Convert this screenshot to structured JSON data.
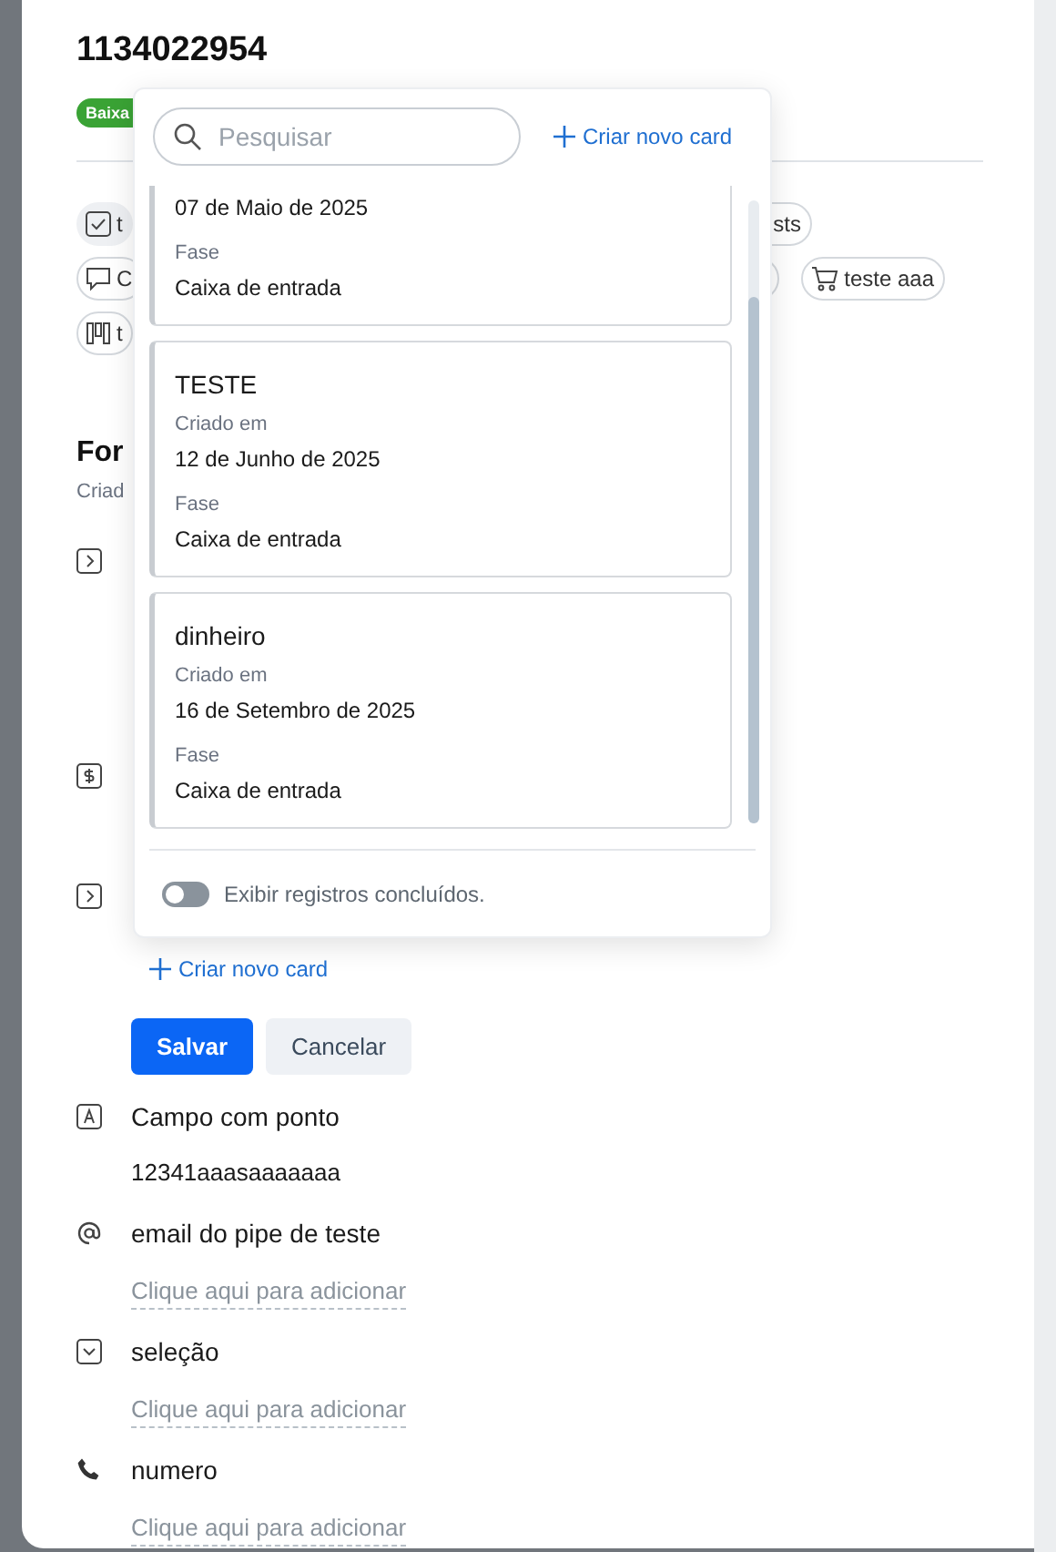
{
  "card": {
    "title": "1134022954",
    "badge": "Baixa",
    "chips": [
      {
        "kind": "checklist",
        "label": "t",
        "selected": true
      },
      {
        "kind": "plain",
        "label": "sts",
        "selected": false
      },
      {
        "kind": "comment",
        "label": "C",
        "selected": false
      },
      {
        "kind": "empty",
        "selected": false
      },
      {
        "kind": "cart",
        "label": "teste aaa",
        "selected": false
      },
      {
        "kind": "kanban",
        "label": "t",
        "selected": false
      }
    ],
    "section": {
      "title": "For",
      "subtitle": "Criad"
    },
    "create_link": "Criar novo card",
    "buttons": {
      "save": "Salvar",
      "cancel": "Cancelar"
    },
    "fields": [
      {
        "kind": "text",
        "label": "Campo com ponto",
        "value": "12341aaasaaaaaaa"
      },
      {
        "kind": "email",
        "label": "email do pipe de teste",
        "placeholder": "Clique aqui para adicionar"
      },
      {
        "kind": "select",
        "label": "seleção",
        "placeholder": "Clique aqui para adicionar"
      },
      {
        "kind": "phone",
        "label": "numero",
        "placeholder": "Clique aqui para adicionar"
      }
    ]
  },
  "popover": {
    "search": {
      "placeholder": "Pesquisar"
    },
    "create_link": "Criar novo card",
    "records": [
      {
        "date": "07 de Maio de 2025",
        "phase_label": "Fase",
        "phase": "Caixa de entrada"
      },
      {
        "title": "TESTE",
        "created_label": "Criado em",
        "date": "12 de Junho de 2025",
        "phase_label": "Fase",
        "phase": "Caixa de entrada"
      },
      {
        "title": "dinheiro",
        "created_label": "Criado em",
        "date": "16 de Setembro de 2025",
        "phase_label": "Fase",
        "phase": "Caixa de entrada"
      }
    ],
    "show_completed": {
      "label": "Exibir registros concluídos.",
      "on": false
    }
  }
}
